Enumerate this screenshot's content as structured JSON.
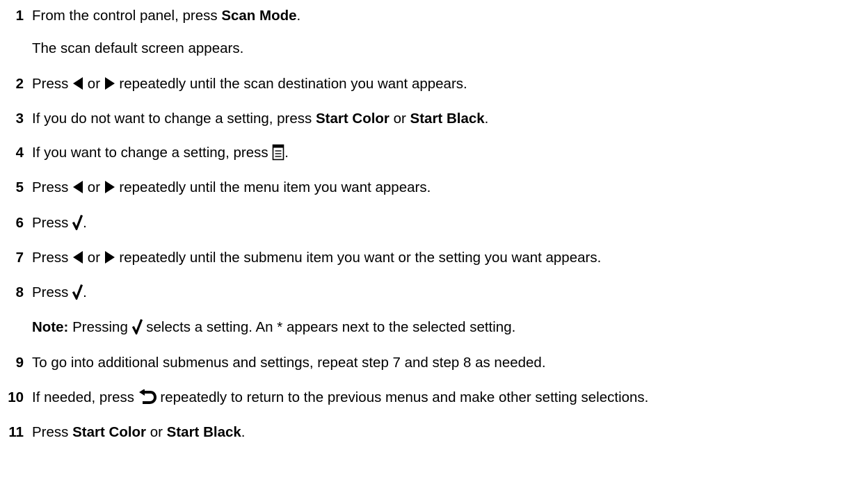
{
  "steps": [
    {
      "num": "1",
      "parts": [
        "From the control panel, press ",
        "Scan Mode",
        "."
      ]
    },
    {
      "num": "",
      "parts": [
        "The scan default screen appears."
      ]
    },
    {
      "num": "2",
      "parts": [
        "Press ",
        " or ",
        " repeatedly until the scan destination you want appears."
      ],
      "icons": [
        "left-arrow-icon",
        "right-arrow-icon"
      ]
    },
    {
      "num": "3",
      "parts": [
        "If you do not want to change a setting, press ",
        "Start Color",
        " or ",
        "Start Black",
        "."
      ]
    },
    {
      "num": "4",
      "parts": [
        "If you want to change a setting, press ",
        "."
      ],
      "icons": [
        "menu-icon"
      ]
    },
    {
      "num": "5",
      "parts": [
        "Press ",
        " or ",
        " repeatedly until the menu item you want appears."
      ],
      "icons": [
        "left-arrow-icon",
        "right-arrow-icon"
      ]
    },
    {
      "num": "6",
      "parts": [
        "Press ",
        "."
      ],
      "icons": [
        "checkmark-icon"
      ]
    },
    {
      "num": "7",
      "parts": [
        "Press ",
        " or ",
        " repeatedly until the submenu item you want or the setting you want appears."
      ],
      "icons": [
        "left-arrow-icon",
        "right-arrow-icon"
      ]
    },
    {
      "num": "8",
      "parts": [
        "Press ",
        "."
      ],
      "icons": [
        "checkmark-icon"
      ]
    },
    {
      "num": "",
      "parts": [
        "Note:",
        " Pressing ",
        " selects a setting. An * appears next to the selected setting."
      ],
      "icons": [
        "checkmark-icon"
      ]
    },
    {
      "num": "9",
      "parts": [
        "To go into additional submenus and settings, repeat step 7 and step 8 as needed."
      ]
    },
    {
      "num": "10",
      "parts": [
        "If needed, press ",
        " repeatedly to return to the previous menus and make other setting selections."
      ],
      "icons": [
        "back-arrow-icon"
      ]
    },
    {
      "num": "11",
      "parts": [
        "Press ",
        "Start Color",
        " or ",
        "Start Black",
        "."
      ]
    }
  ],
  "icon_color": "#000000"
}
